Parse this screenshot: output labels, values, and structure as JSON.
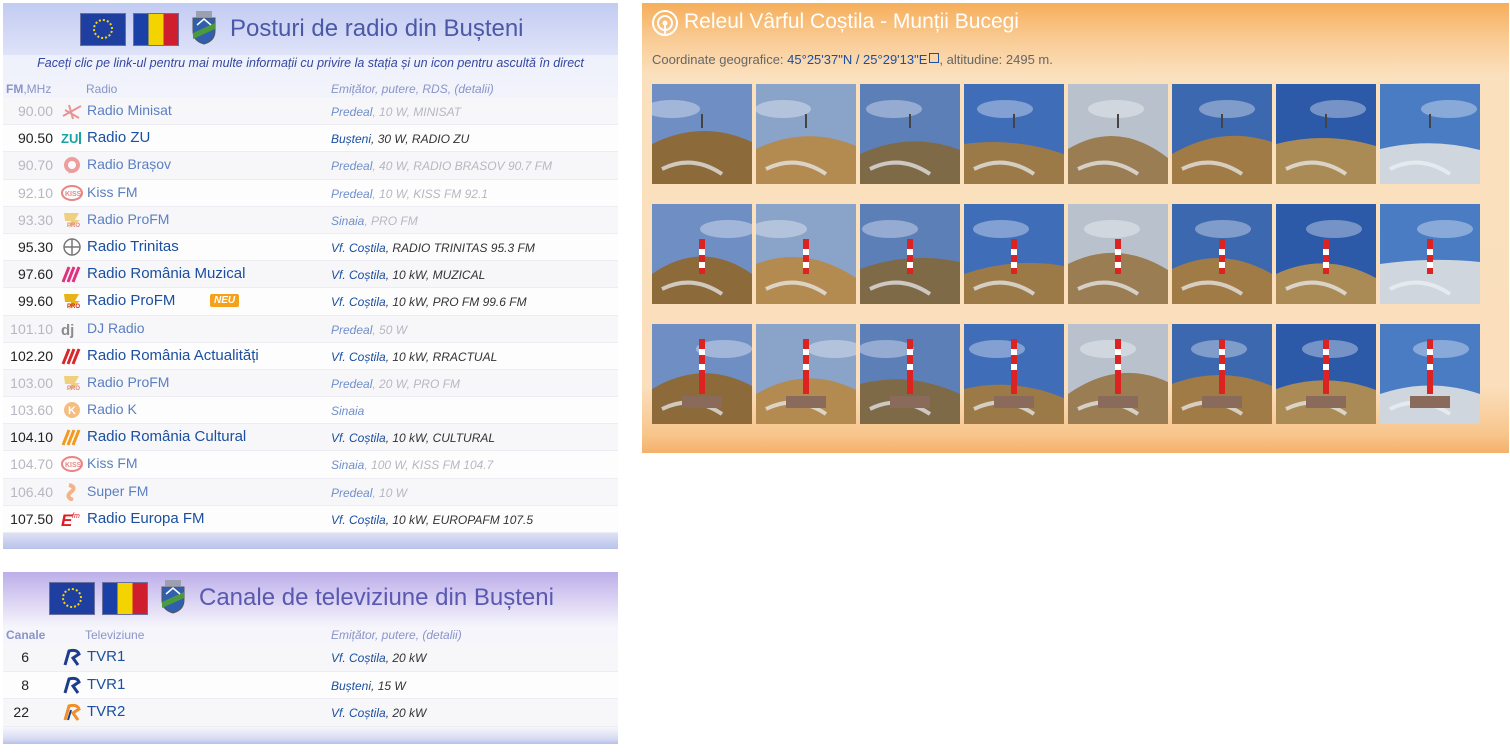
{
  "radio": {
    "title": "Posturi de radio din Bușteni",
    "subtitle": "Faceți clic pe link-ul pentru mai multe informații cu privire la stația și un icon pentru ascultă în direct",
    "col_freq_bold": "FM",
    "col_freq_rest": ",MHz",
    "col_name": "Radio",
    "col_info": "Emițător, putere, RDS, (detalii)",
    "badge": "NEU",
    "rows": [
      {
        "freq": "90.00",
        "name": "Radio Minisat",
        "place": "Predeal",
        "rest": ", 10 W, MINISAT",
        "dim": true,
        "logo": "minisat"
      },
      {
        "freq": "90.50",
        "name": "Radio ZU",
        "place": "Bușteni",
        "rest": ", 30 W, RADIO ZU",
        "dim": false,
        "logo": "zu"
      },
      {
        "freq": "90.70",
        "name": "Radio Brașov",
        "place": "Predeal",
        "rest": ", 40 W, RADIO BRASOV 90.7 FM",
        "dim": true,
        "logo": "brasov"
      },
      {
        "freq": "92.10",
        "name": "Kiss FM",
        "place": "Predeal",
        "rest": ", 10 W, KISS FM 92.1",
        "dim": true,
        "logo": "kiss"
      },
      {
        "freq": "93.30",
        "name": "Radio ProFM",
        "place": "Sinaia",
        "rest": ", PRO FM",
        "dim": true,
        "logo": "profm"
      },
      {
        "freq": "95.30",
        "name": "Radio Trinitas",
        "place": "Vf. Coștila",
        "rest": ", RADIO TRINITAS 95.3 FM",
        "dim": false,
        "logo": "trinitas"
      },
      {
        "freq": "97.60",
        "name": "Radio România Muzical",
        "place": "Vf. Coștila",
        "rest": ", 10 kW, MUZICAL",
        "dim": false,
        "logo": "srr-pink"
      },
      {
        "freq": "99.60",
        "name": "Radio ProFM",
        "place": "Vf. Coștila",
        "rest": ", 10 kW, PRO FM 99.6 FM",
        "dim": false,
        "logo": "profm",
        "badge": true
      },
      {
        "freq": "101.10",
        "name": "DJ Radio",
        "place": "Predeal",
        "rest": ", 50 W",
        "dim": true,
        "logo": "dj"
      },
      {
        "freq": "102.20",
        "name": "Radio România Actualități",
        "place": "Vf. Coștila",
        "rest": ", 10 kW, RRACTUAL",
        "dim": false,
        "logo": "srr-red"
      },
      {
        "freq": "103.00",
        "name": "Radio ProFM",
        "place": "Predeal",
        "rest": ", 20 W, PRO FM",
        "dim": true,
        "logo": "profm"
      },
      {
        "freq": "103.60",
        "name": "Radio K",
        "place": "Sinaia",
        "rest": "",
        "dim": true,
        "logo": "k"
      },
      {
        "freq": "104.10",
        "name": "Radio România Cultural",
        "place": "Vf. Coștila",
        "rest": ", 10 kW, CULTURAL",
        "dim": false,
        "logo": "srr-orange"
      },
      {
        "freq": "104.70",
        "name": "Kiss FM",
        "place": "Sinaia",
        "rest": ", 100 W, KISS FM 104.7",
        "dim": true,
        "logo": "kiss"
      },
      {
        "freq": "106.40",
        "name": "Super FM",
        "place": "Predeal",
        "rest": ", 10 W",
        "dim": true,
        "logo": "super"
      },
      {
        "freq": "107.50",
        "name": "Radio Europa FM",
        "place": "Vf. Coștila",
        "rest": ", 10 kW, EUROPAFM 107.5",
        "dim": false,
        "logo": "europa"
      }
    ]
  },
  "tv": {
    "title": "Canale de televiziune din Bușteni",
    "col_ch": "Canale",
    "col_name": "Televiziune",
    "col_info": "Emițător, putere, (detalii)",
    "rows": [
      {
        "ch": "6",
        "name": "TVR1",
        "place": "Vf. Coștila",
        "rest": ", 20 kW",
        "logo": "tvr1"
      },
      {
        "ch": "8",
        "name": "TVR1",
        "place": "Bușteni",
        "rest": ", 15 W",
        "logo": "tvr1"
      },
      {
        "ch": "22",
        "name": "TVR2",
        "place": "Vf. Coștila",
        "rest": ", 20 kW",
        "logo": "tvr2"
      }
    ]
  },
  "site": {
    "title": "Releul Vârful Coștila - Munții Bucegi",
    "coords_label": "Coordinate geografice: ",
    "coords_value": "45°25'37\"N / 25°29'13\"E",
    "altitude": ", altitudine: 2495 m.",
    "photo_count": 24
  },
  "colors": {
    "link": "#1b4fa0",
    "radio_header": "#c2cbf2",
    "site_header": "#f6ae5a",
    "tv_header": "#bcaee9"
  }
}
